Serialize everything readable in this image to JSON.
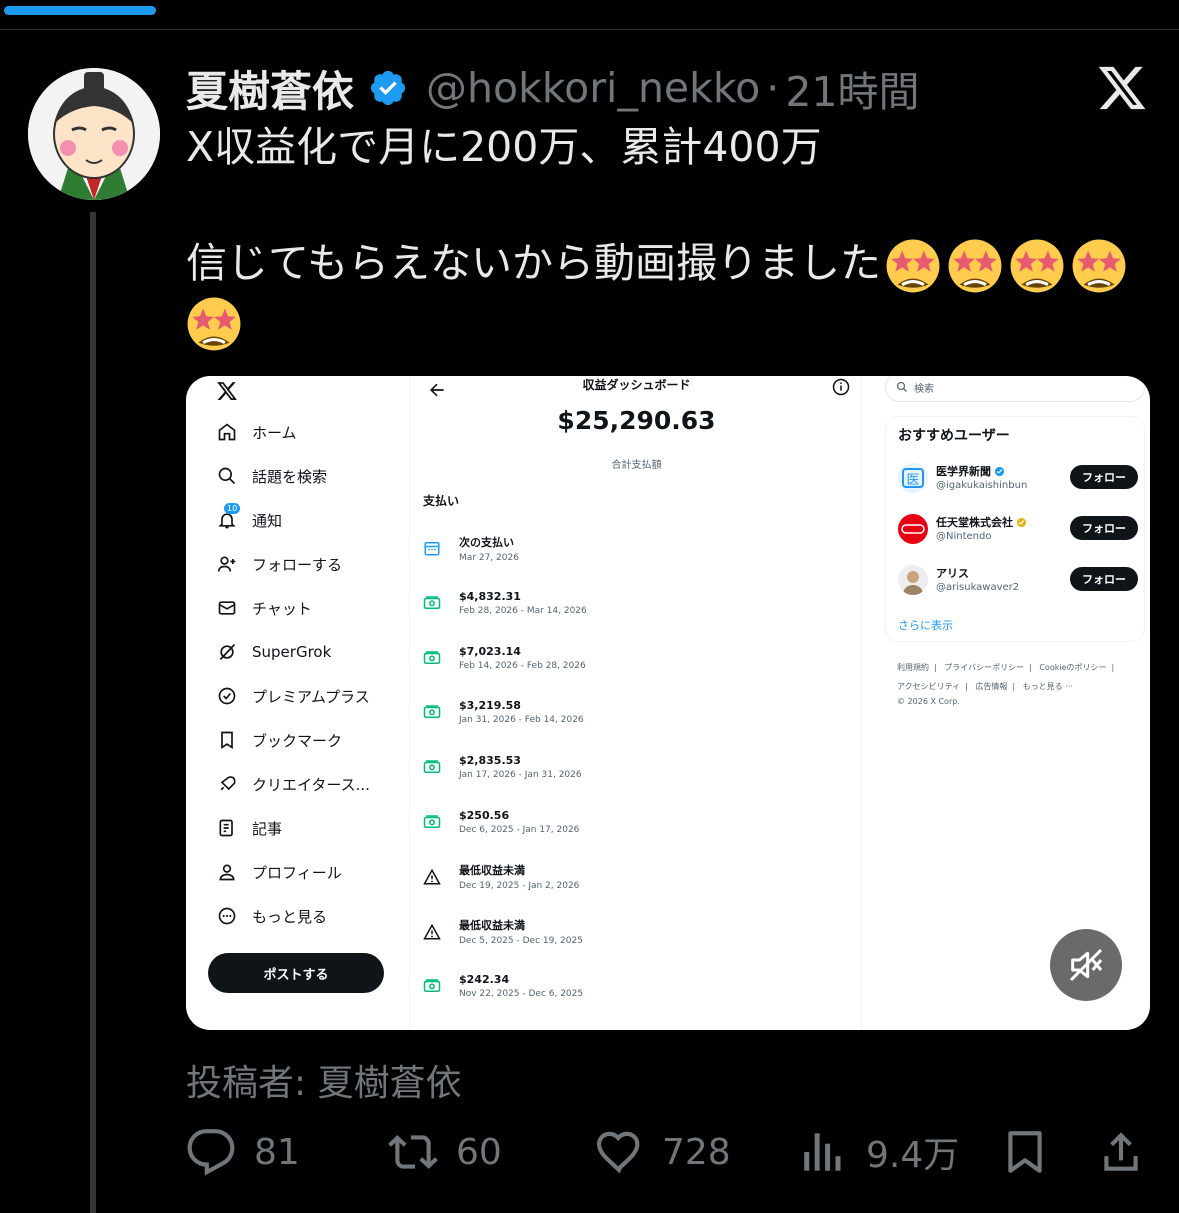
{
  "tweet": {
    "display_name": "夏樹蒼依",
    "handle": "@hokkori_nekko",
    "separator": "·",
    "time": "21時間",
    "line1": "X収益化で月に200万、累計400万",
    "line2": "信じてもらえないから動画撮りました",
    "emoji_name": "star-struck",
    "attribution": "投稿者: 夏樹蒼依"
  },
  "media": {
    "nav": {
      "items": [
        {
          "label": "ホーム",
          "icon": "home-icon"
        },
        {
          "label": "話題を検索",
          "icon": "search-icon"
        },
        {
          "label": "通知",
          "icon": "bell-icon",
          "badge": "10"
        },
        {
          "label": "フォローする",
          "icon": "follow-icon"
        },
        {
          "label": "チャット",
          "icon": "mail-icon"
        },
        {
          "label": "SuperGrok",
          "icon": "grok-icon"
        },
        {
          "label": "プレミアムプラス",
          "icon": "verified-badge-icon"
        },
        {
          "label": "ブックマーク",
          "icon": "bookmark-icon"
        },
        {
          "label": "クリエイタース...",
          "icon": "rocket-icon"
        },
        {
          "label": "記事",
          "icon": "article-icon"
        },
        {
          "label": "プロフィール",
          "icon": "profile-icon"
        },
        {
          "label": "もっと見る",
          "icon": "more-icon"
        }
      ],
      "post_button": "ポストする"
    },
    "dashboard": {
      "title": "収益ダッシュボード",
      "total": "$25,290.63",
      "total_label": "合計支払額",
      "payments_heading": "支払い",
      "payments": [
        {
          "title": "次の支払い",
          "date": "Mar 27, 2026",
          "icon": "calendar-icon"
        },
        {
          "title": "$4,832.31",
          "date": "Feb 28, 2026 - Mar 14, 2026",
          "icon": "money-icon"
        },
        {
          "title": "$7,023.14",
          "date": "Feb 14, 2026 - Feb 28, 2026",
          "icon": "money-icon"
        },
        {
          "title": "$3,219.58",
          "date": "Jan 31, 2026 - Feb 14, 2026",
          "icon": "money-icon"
        },
        {
          "title": "$2,835.53",
          "date": "Jan 17, 2026 - Jan 31, 2026",
          "icon": "money-icon"
        },
        {
          "title": "$250.56",
          "date": "Dec 6, 2025 - Jan 17, 2026",
          "icon": "money-icon"
        },
        {
          "title": "最低収益未満",
          "date": "Dec 19, 2025 - Jan 2, 2026",
          "icon": "warning-icon"
        },
        {
          "title": "最低収益未満",
          "date": "Dec 5, 2025 - Dec 19, 2025",
          "icon": "warning-icon"
        },
        {
          "title": "$242.34",
          "date": "Nov 22, 2025 - Dec 6, 2025",
          "icon": "money-icon"
        }
      ]
    },
    "sidebar": {
      "search_placeholder": "検索",
      "recommend_title": "おすすめユーザー",
      "users": [
        {
          "name": "医学界新聞",
          "handle": "@igakukaishinbun",
          "follow": "フォロー",
          "verified": "blue"
        },
        {
          "name": "任天堂株式会社",
          "handle": "@Nintendo",
          "follow": "フォロー",
          "verified": "gold"
        },
        {
          "name": "アリス",
          "handle": "@arisukawaver2",
          "follow": "フォロー",
          "verified": ""
        }
      ],
      "show_more": "さらに表示",
      "footer": {
        "terms": "利用規約",
        "privacy": "プライバシーポリシー",
        "cookie": "Cookieのポリシー",
        "accessibility": "アクセシビリティ",
        "ads": "広告情報",
        "more": "もっと見る ···",
        "copyright": "© 2026 X Corp."
      }
    }
  },
  "actions": {
    "replies": "81",
    "reposts": "60",
    "likes": "728",
    "views": "9.4万"
  },
  "colors": {
    "accent": "#1d9bf0",
    "background": "#000000",
    "muted": "#71767b",
    "money_green": "#00ba7c"
  }
}
